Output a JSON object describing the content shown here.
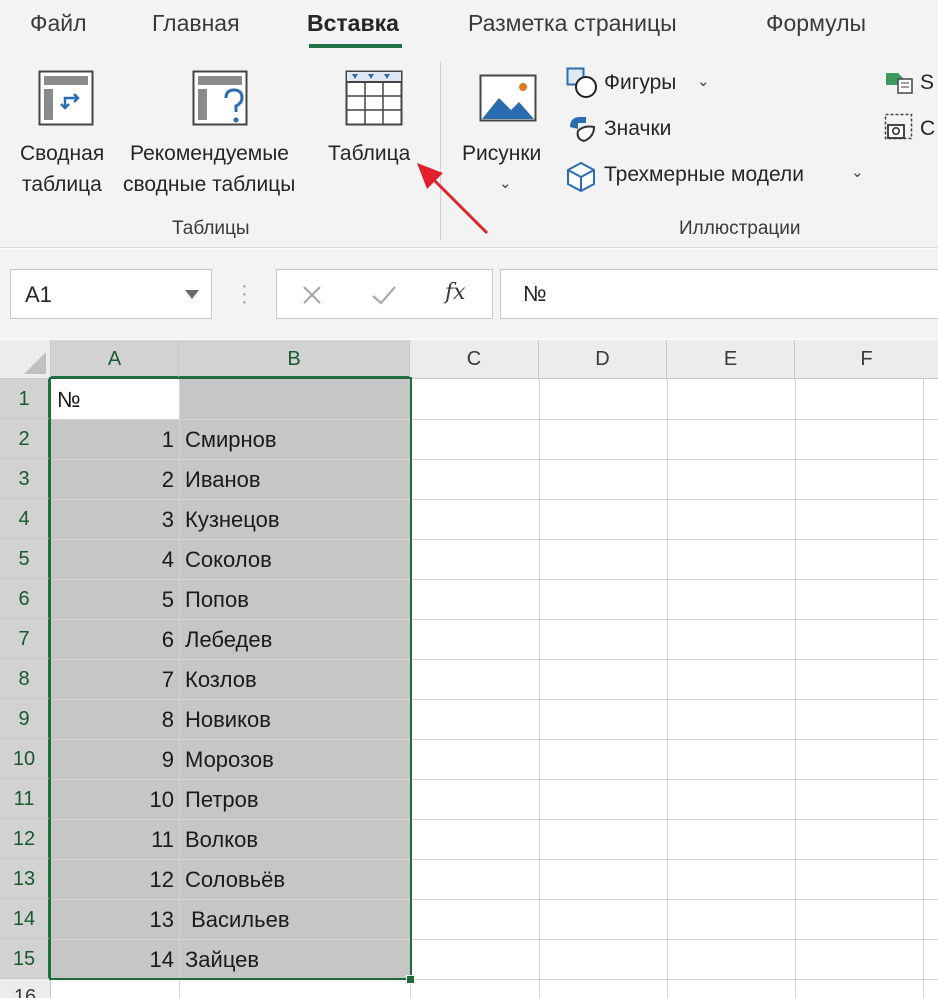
{
  "ribbon": {
    "tabs": [
      "Файл",
      "Главная",
      "Вставка",
      "Разметка страницы",
      "Формулы"
    ],
    "active_tab": "Вставка",
    "accent": "#217346",
    "groups": {
      "tables": {
        "label": "Таблицы",
        "pivot_line1": "Сводная",
        "pivot_line2": "таблица",
        "recommended_line1": "Рекомендуемые",
        "recommended_line2": "сводные таблицы",
        "table": "Таблица"
      },
      "illustrations": {
        "label": "Иллюстрации",
        "pictures": "Рисунки",
        "shapes": "Фигуры",
        "icons": "Значки",
        "models3d": "Трехмерные модели"
      }
    },
    "partial_right_top": "S",
    "partial_right_bottom": "С"
  },
  "formula_bar": {
    "name_box": "A1",
    "fx_label": "fx",
    "value": "№"
  },
  "grid": {
    "columns": [
      "A",
      "B",
      "C",
      "D",
      "E",
      "F"
    ],
    "rows": [
      "1",
      "2",
      "3",
      "4",
      "5",
      "6",
      "7",
      "8",
      "9",
      "10",
      "11",
      "12",
      "13",
      "14",
      "15",
      "16"
    ],
    "header_row": {
      "a": "№",
      "b": ""
    },
    "data": [
      {
        "a": "1",
        "b": "Смирнов"
      },
      {
        "a": "2",
        "b": "Иванов"
      },
      {
        "a": "3",
        "b": "Кузнецов"
      },
      {
        "a": "4",
        "b": "Соколов"
      },
      {
        "a": "5",
        "b": "Попов"
      },
      {
        "a": "6",
        "b": "Лебедев"
      },
      {
        "a": "7",
        "b": "Козлов"
      },
      {
        "a": "8",
        "b": "Новиков"
      },
      {
        "a": "9",
        "b": "Морозов"
      },
      {
        "a": "10",
        "b": "Петров"
      },
      {
        "a": "11",
        "b": "Волков"
      },
      {
        "a": "12",
        "b": "Соловьёв"
      },
      {
        "a": "13",
        "b": " Васильев"
      },
      {
        "a": "14",
        "b": "Зайцев"
      }
    ],
    "selection_color": "#1f6b3b",
    "annotation_arrow_color": "#e0212b"
  }
}
